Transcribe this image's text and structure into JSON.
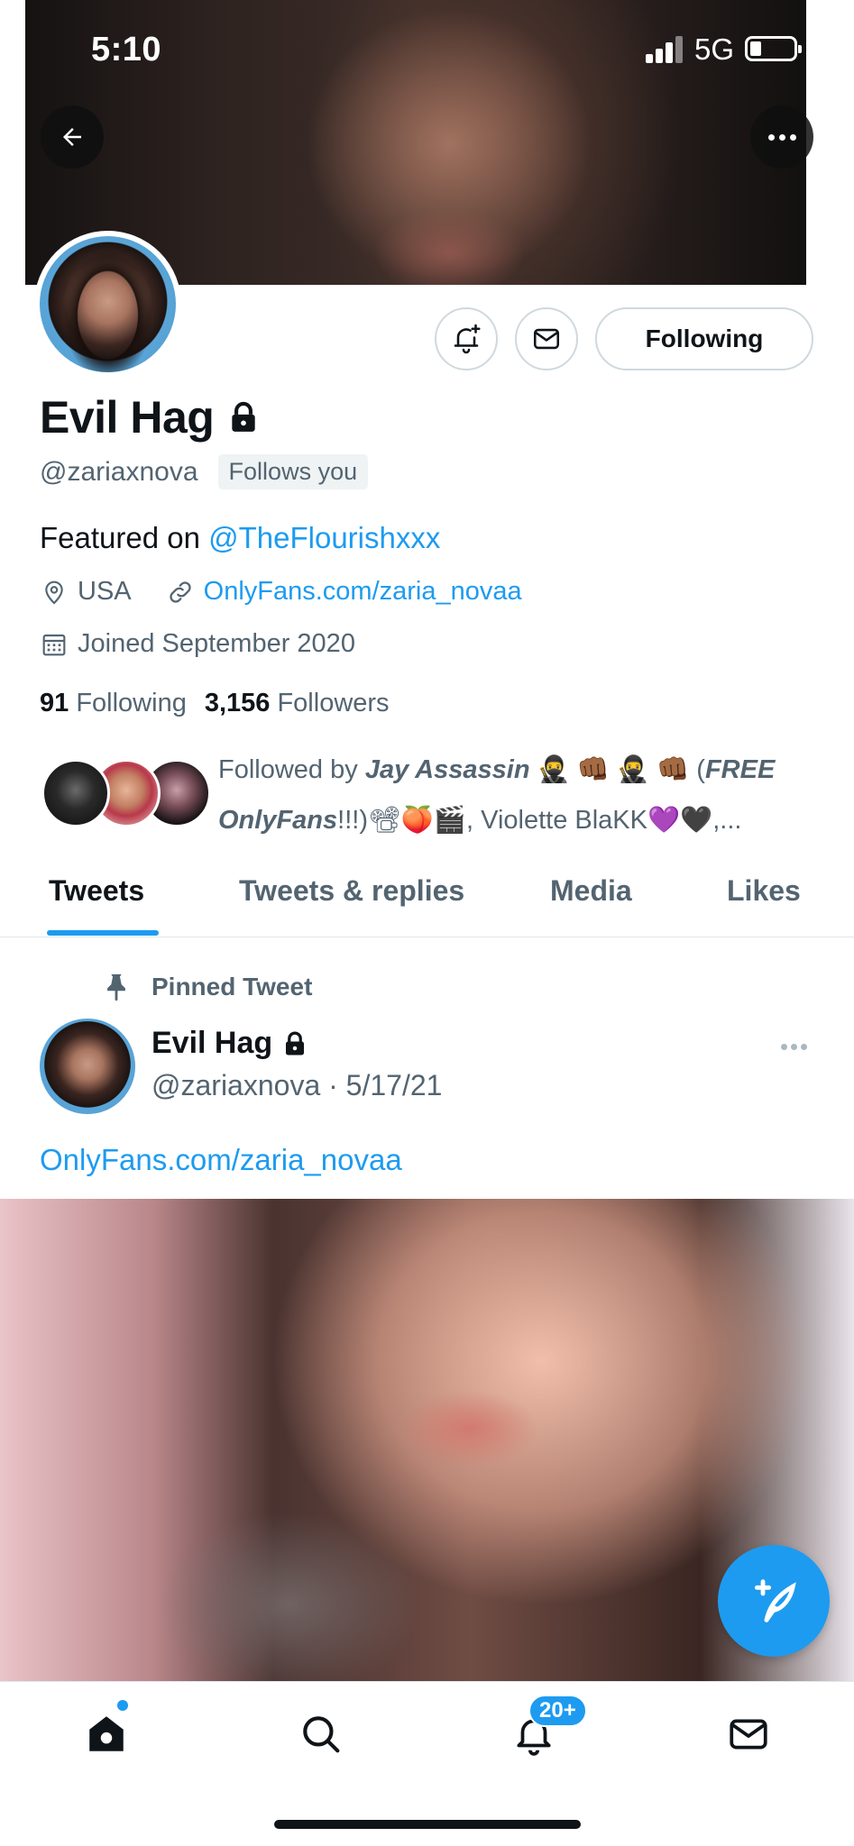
{
  "status_bar": {
    "time": "5:10",
    "network": "5G"
  },
  "profile": {
    "display_name": "Evil Hag",
    "handle": "@zariaxnova",
    "follows_you": "Follows you",
    "following_button": "Following",
    "bio_prefix": "Featured on ",
    "bio_mention": "@TheFlourishxxx",
    "location": "USA",
    "website": "OnlyFans.com/zaria_novaa",
    "joined": "Joined September 2020",
    "following_count": "91",
    "following_label": "Following",
    "followers_count": "3,156",
    "followers_label": "Followers",
    "followed_by_line1_prefix": "Followed by ",
    "followed_by_line1_name": "Jay Assassin",
    "followed_by_line1_emoji": " 🥷 👊🏾 🥷 👊🏾 (",
    "followed_by_line1_free": "FREE",
    "followed_by_line2_italic": "OnlyFans",
    "followed_by_line2_rest": "!!!)📽🍑🎬, Violette BlaKK💜🖤,..."
  },
  "tabs": [
    {
      "label": "Tweets",
      "active": true
    },
    {
      "label": "Tweets & replies",
      "active": false
    },
    {
      "label": "Media",
      "active": false
    },
    {
      "label": "Likes",
      "active": false
    }
  ],
  "pinned_tweet": {
    "pinned_label": "Pinned Tweet",
    "author_name": "Evil Hag",
    "author_handle": "@zariaxnova",
    "separator": " · ",
    "date": "5/17/21",
    "link_text": "OnlyFans.com/zaria_novaa"
  },
  "bottom_nav": {
    "items": [
      "home-icon",
      "search-icon",
      "notifications-icon",
      "messages-icon"
    ],
    "notification_badge": "20+"
  },
  "colors": {
    "accent": "#1d9bf0",
    "secondary_text": "#536471",
    "primary_text": "#0f1419"
  }
}
